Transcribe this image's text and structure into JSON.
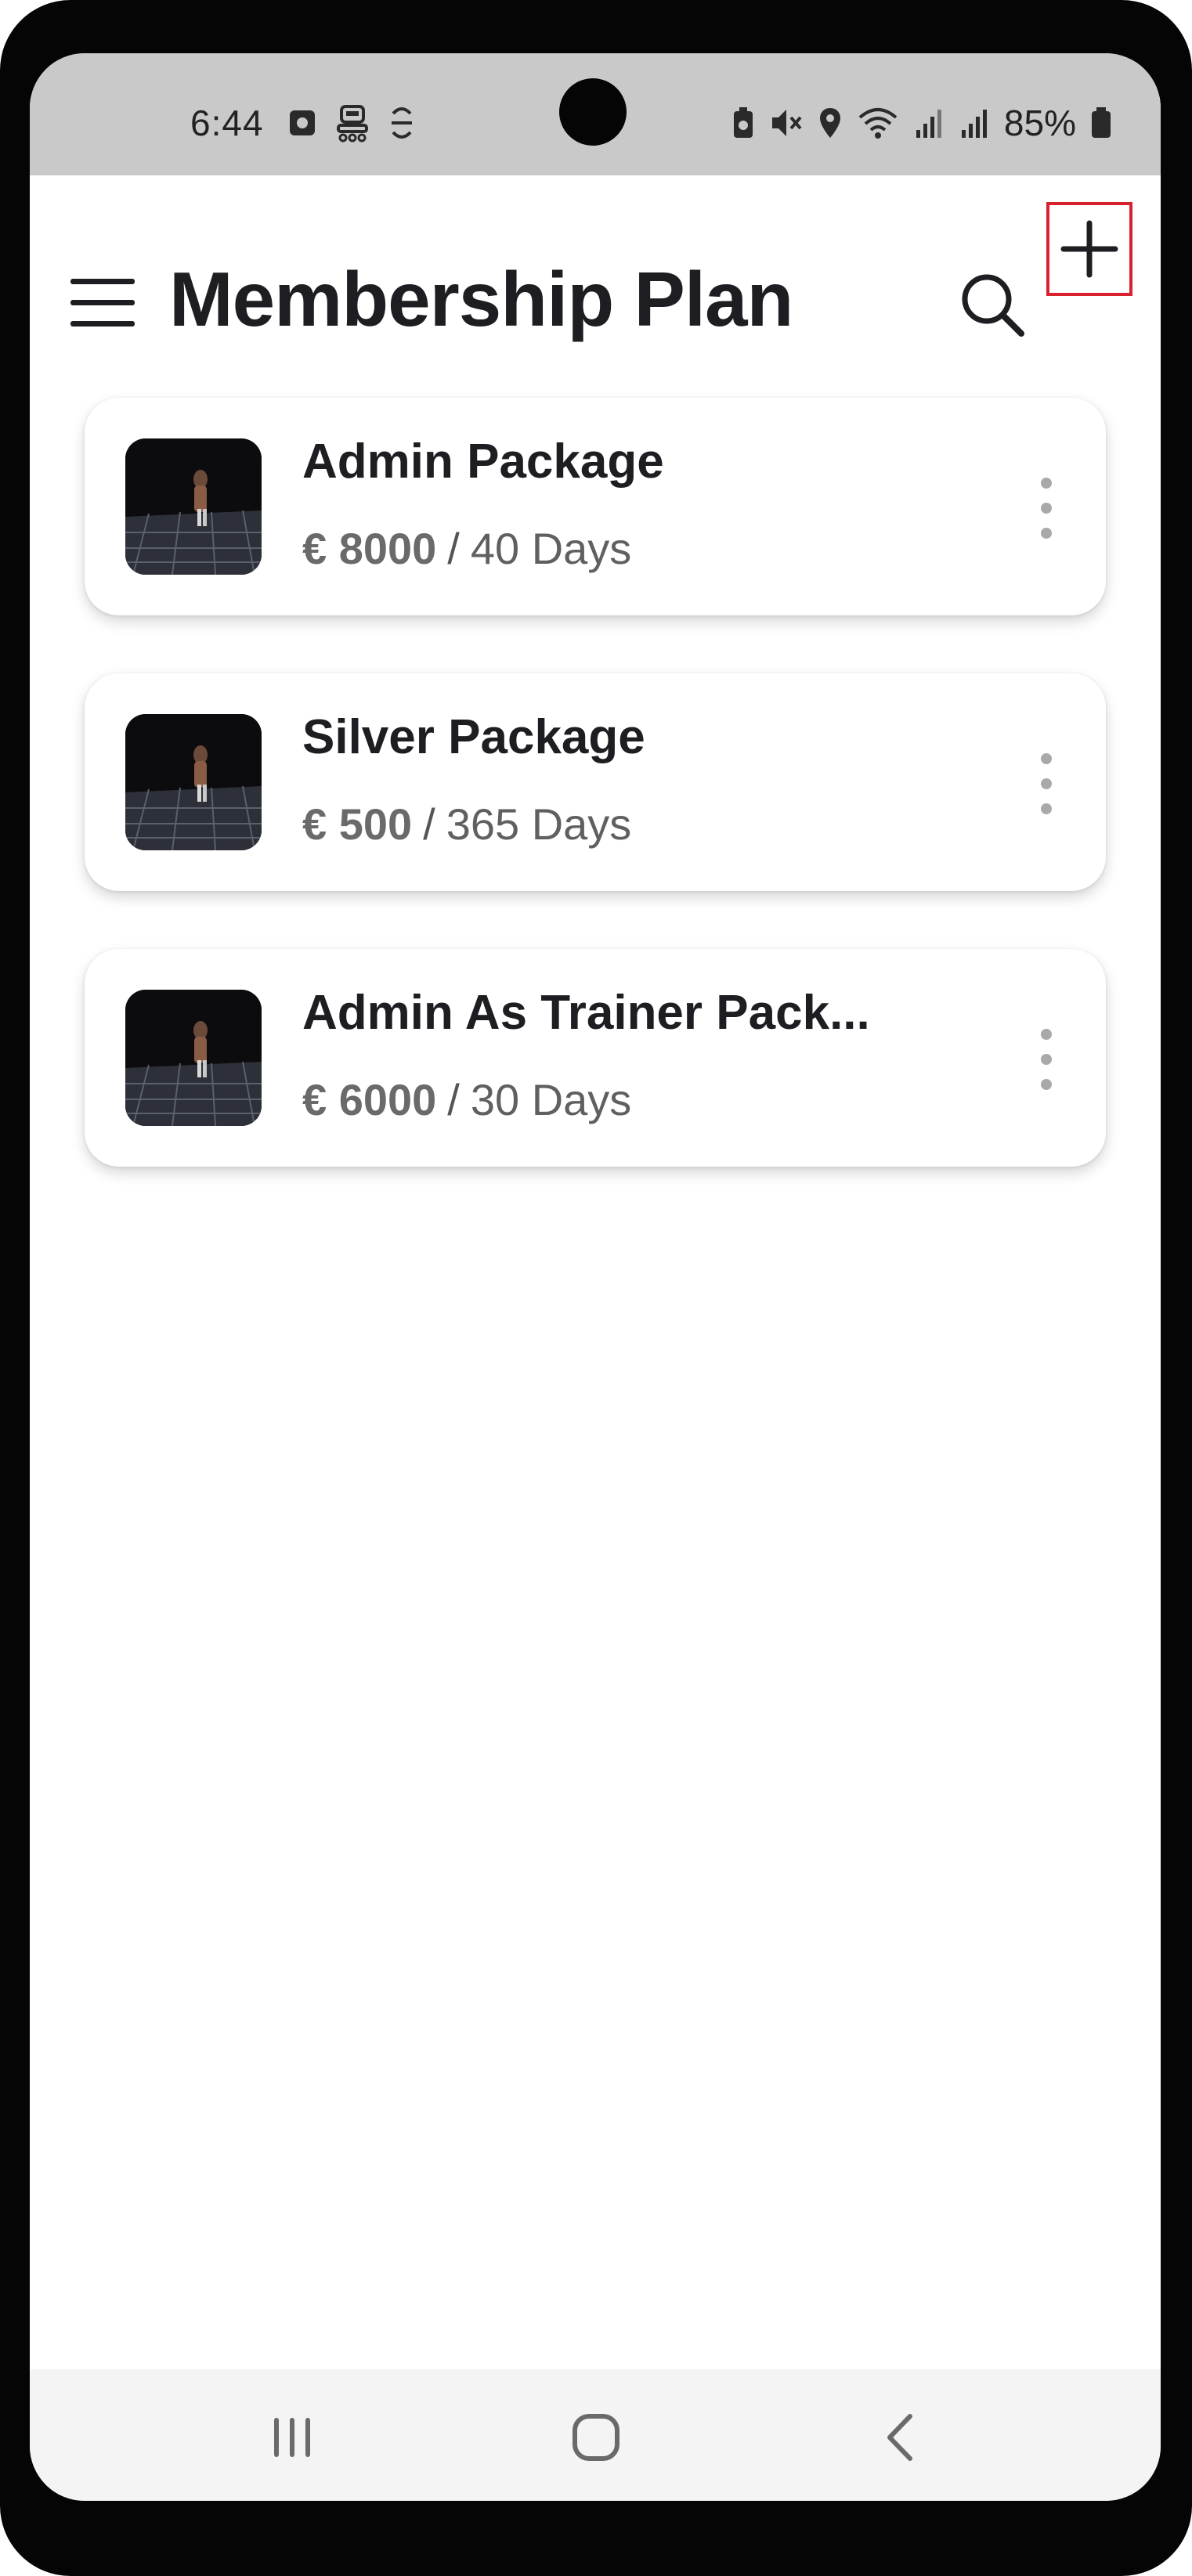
{
  "status": {
    "time": "6:44",
    "battery": "85%"
  },
  "appbar": {
    "title": "Membership Plan",
    "menu_icon": "hamburger-menu-icon",
    "search_icon": "search-icon",
    "add_icon": "plus-icon"
  },
  "plans": [
    {
      "name": "Admin Package",
      "price": "€ 8000",
      "separator": "/",
      "duration": "40 Days"
    },
    {
      "name": "Silver Package",
      "price": "€ 500",
      "separator": "/",
      "duration": "365 Days"
    },
    {
      "name": "Admin As Trainer Pack...",
      "price": "€ 6000",
      "separator": "/",
      "duration": "30 Days"
    }
  ],
  "navbar": {
    "recents_icon": "recents-icon",
    "home_icon": "home-icon",
    "back_icon": "back-icon"
  },
  "colors": {
    "title": "#1d1d22",
    "add_highlight": "#d9202e",
    "status_bar": "#c9c9c9"
  }
}
